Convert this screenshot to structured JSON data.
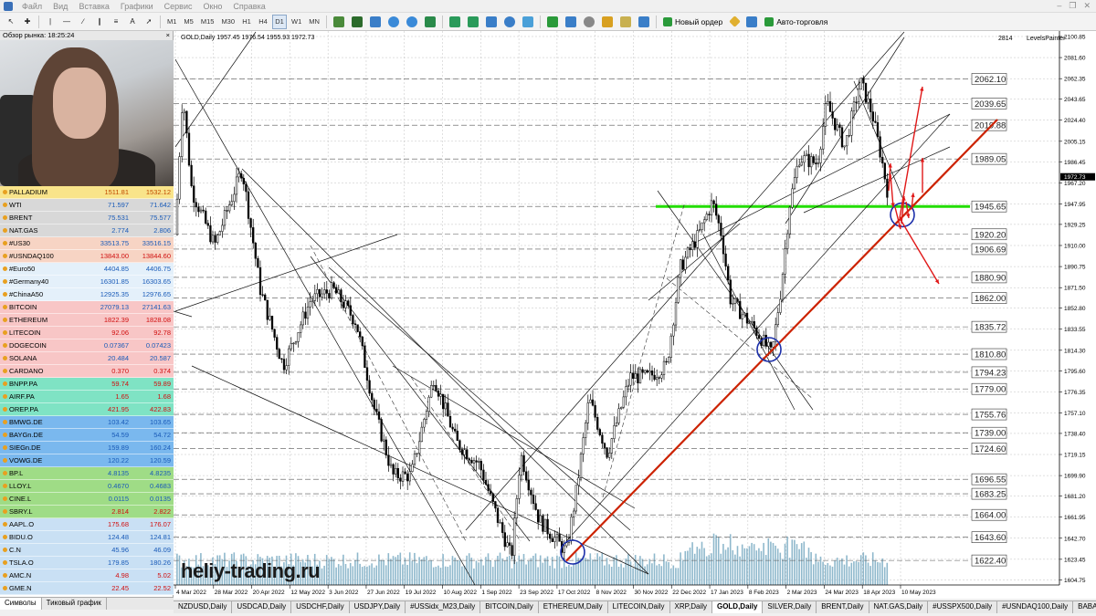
{
  "menu": [
    "Файл",
    "Вид",
    "Вставка",
    "Графики",
    "Сервис",
    "Окно",
    "Справка"
  ],
  "toolbar": {
    "timeframes": [
      "M1",
      "M5",
      "M15",
      "M30",
      "H1",
      "H4",
      "D1",
      "W1",
      "MN"
    ],
    "active_timeframe": "D1",
    "new_order": "Новый ордер",
    "auto_trading": "Авто-торговля"
  },
  "market_watch": {
    "title": "Обзор рынка: 18:25:24",
    "symbols": [
      {
        "name": "PALLADIUM",
        "bid": "1511.81",
        "ask": "1532.12",
        "bg": "#f9e48a",
        "cls": "org"
      },
      {
        "name": "WTI",
        "bid": "71.597",
        "ask": "71.642",
        "bg": "#d8d8d8",
        "cls": ""
      },
      {
        "name": "BRENT",
        "bid": "75.531",
        "ask": "75.577",
        "bg": "#d8d8d8",
        "cls": ""
      },
      {
        "name": "NAT.GAS",
        "bid": "2.774",
        "ask": "2.806",
        "bg": "#d8d8d8",
        "cls": ""
      },
      {
        "name": "#US30",
        "bid": "33513.75",
        "ask": "33516.15",
        "bg": "#f7d4c4",
        "cls": ""
      },
      {
        "name": "#USNDAQ100",
        "bid": "13843.00",
        "ask": "13844.60",
        "bg": "#f7d4c4",
        "cls": "red"
      },
      {
        "name": "#Euro50",
        "bid": "4404.85",
        "ask": "4406.75",
        "bg": "#e4f0fa",
        "cls": ""
      },
      {
        "name": "#Germany40",
        "bid": "16301.85",
        "ask": "16303.65",
        "bg": "#e4f0fa",
        "cls": ""
      },
      {
        "name": "#ChinaA50",
        "bid": "12925.35",
        "ask": "12976.65",
        "bg": "#e4f0fa",
        "cls": ""
      },
      {
        "name": "BITCOIN",
        "bid": "27079.13",
        "ask": "27141.63",
        "bg": "#f8c6c6",
        "cls": ""
      },
      {
        "name": "ETHEREUM",
        "bid": "1822.39",
        "ask": "1828.08",
        "bg": "#f8c6c6",
        "cls": "red"
      },
      {
        "name": "LITECOIN",
        "bid": "92.06",
        "ask": "92.78",
        "bg": "#f8c6c6",
        "cls": "red"
      },
      {
        "name": "DOGECOIN",
        "bid": "0.07367",
        "ask": "0.07423",
        "bg": "#f8c6c6",
        "cls": ""
      },
      {
        "name": "SOLANA",
        "bid": "20.484",
        "ask": "20.587",
        "bg": "#f8c6c6",
        "cls": ""
      },
      {
        "name": "CARDANO",
        "bid": "0.370",
        "ask": "0.374",
        "bg": "#f8c6c6",
        "cls": "red"
      },
      {
        "name": "BNPP.PA",
        "bid": "59.74",
        "ask": "59.89",
        "bg": "#7fe3c4",
        "cls": "red"
      },
      {
        "name": "AIRF.PA",
        "bid": "1.65",
        "ask": "1.68",
        "bg": "#7fe3c4",
        "cls": "red"
      },
      {
        "name": "OREP.PA",
        "bid": "421.95",
        "ask": "422.83",
        "bg": "#7fe3c4",
        "cls": "red"
      },
      {
        "name": "BMWG.DE",
        "bid": "103.42",
        "ask": "103.65",
        "bg": "#7ab8ee",
        "cls": ""
      },
      {
        "name": "BAYGn.DE",
        "bid": "54.59",
        "ask": "54.72",
        "bg": "#7ab8ee",
        "cls": ""
      },
      {
        "name": "SIEGn.DE",
        "bid": "159.89",
        "ask": "160.24",
        "bg": "#7ab8ee",
        "cls": ""
      },
      {
        "name": "VOWG.DE",
        "bid": "120.22",
        "ask": "120.59",
        "bg": "#7ab8ee",
        "cls": ""
      },
      {
        "name": "BP.L",
        "bid": "4.8135",
        "ask": "4.8235",
        "bg": "#9fdc86",
        "cls": ""
      },
      {
        "name": "LLOY.L",
        "bid": "0.4670",
        "ask": "0.4683",
        "bg": "#9fdc86",
        "cls": ""
      },
      {
        "name": "CINE.L",
        "bid": "0.0115",
        "ask": "0.0135",
        "bg": "#9fdc86",
        "cls": ""
      },
      {
        "name": "SBRY.L",
        "bid": "2.814",
        "ask": "2.822",
        "bg": "#9fdc86",
        "cls": "red"
      },
      {
        "name": "AAPL.O",
        "bid": "175.68",
        "ask": "176.07",
        "bg": "#c9e0f4",
        "cls": "red"
      },
      {
        "name": "BIDU.O",
        "bid": "124.48",
        "ask": "124.81",
        "bg": "#c9e0f4",
        "cls": ""
      },
      {
        "name": "C.N",
        "bid": "45.96",
        "ask": "46.09",
        "bg": "#c9e0f4",
        "cls": ""
      },
      {
        "name": "TSLA.O",
        "bid": "179.85",
        "ask": "180.26",
        "bg": "#c9e0f4",
        "cls": ""
      },
      {
        "name": "AMC.N",
        "bid": "4.98",
        "ask": "5.02",
        "bg": "#c9e0f4",
        "cls": "red"
      },
      {
        "name": "GME.N",
        "bid": "22.45",
        "ask": "22.52",
        "bg": "#c9e0f4",
        "cls": "red"
      }
    ],
    "tabs": [
      "Символы",
      "Тиковый график"
    ]
  },
  "chart": {
    "header": "GOLD,Daily  1957.45 1976.54 1955.93 1972.73",
    "indicator": "LevelsPainter",
    "bar_count": "2814",
    "watermark": "heliy-trading.ru",
    "current_price": "1972.73",
    "price_axis": [
      "2100.85",
      "2081.60",
      "2062.35",
      "2043.65",
      "2024.40",
      "2005.15",
      "1986.45",
      "1967.20",
      "1947.95",
      "1929.25",
      "1910.00",
      "1890.75",
      "1871.50",
      "1852.80",
      "1833.55",
      "1814.30",
      "1795.60",
      "1776.35",
      "1757.10",
      "1738.40",
      "1719.15",
      "1699.90",
      "1681.20",
      "1661.95",
      "1642.70",
      "1623.45",
      "1604.75"
    ],
    "date_axis": [
      "4 Mar 2022",
      "28 Mar 2022",
      "20 Apr 2022",
      "12 May 2022",
      "3 Jun 2022",
      "27 Jun 2022",
      "19 Jul 2022",
      "10 Aug 2022",
      "1 Sep 2022",
      "23 Sep 2022",
      "17 Oct 2022",
      "8 Nov 2022",
      "30 Nov 2022",
      "22 Dec 2022",
      "17 Jan 2023",
      "8 Feb 2023",
      "2 Mar 2023",
      "24 Mar 2023",
      "18 Apr 2023",
      "10 May 2023"
    ],
    "levels": [
      "2062.10",
      "2039.65",
      "2019.88",
      "1989.05",
      "1945.65",
      "1920.20",
      "1906.69",
      "1880.90",
      "1862.00",
      "1835.72",
      "1810.80",
      "1794.23",
      "1779.00",
      "1755.76",
      "1739.00",
      "1724.60",
      "1696.55",
      "1683.25",
      "1664.00",
      "1643.60",
      "1622.40"
    ],
    "colors": {
      "background": "#ffffff",
      "candle": "#000000",
      "grid": "#c0c0c0",
      "volume": "#8fb8cc",
      "support_line": "#cc2200",
      "green_level": "#22dd00",
      "circle": "#1c2faa"
    }
  },
  "chart_tabs": [
    "NZDUSD,Daily",
    "USDCAD,Daily",
    "USDCHF,Daily",
    "USDJPY,Daily",
    "#USSidx_M23,Daily",
    "BITCOIN,Daily",
    "ETHEREUM,Daily",
    "LITECOIN,Daily",
    "XRP,Daily",
    "GOLD,Daily",
    "SILVER,Daily",
    "BRENT,Daily",
    "NAT.GAS,Daily",
    "#USSPX500,Daily",
    "#USNDAQ100,Daily",
    "BABA.N,Daily"
  ],
  "active_chart_tab": "GOLD,Daily"
}
